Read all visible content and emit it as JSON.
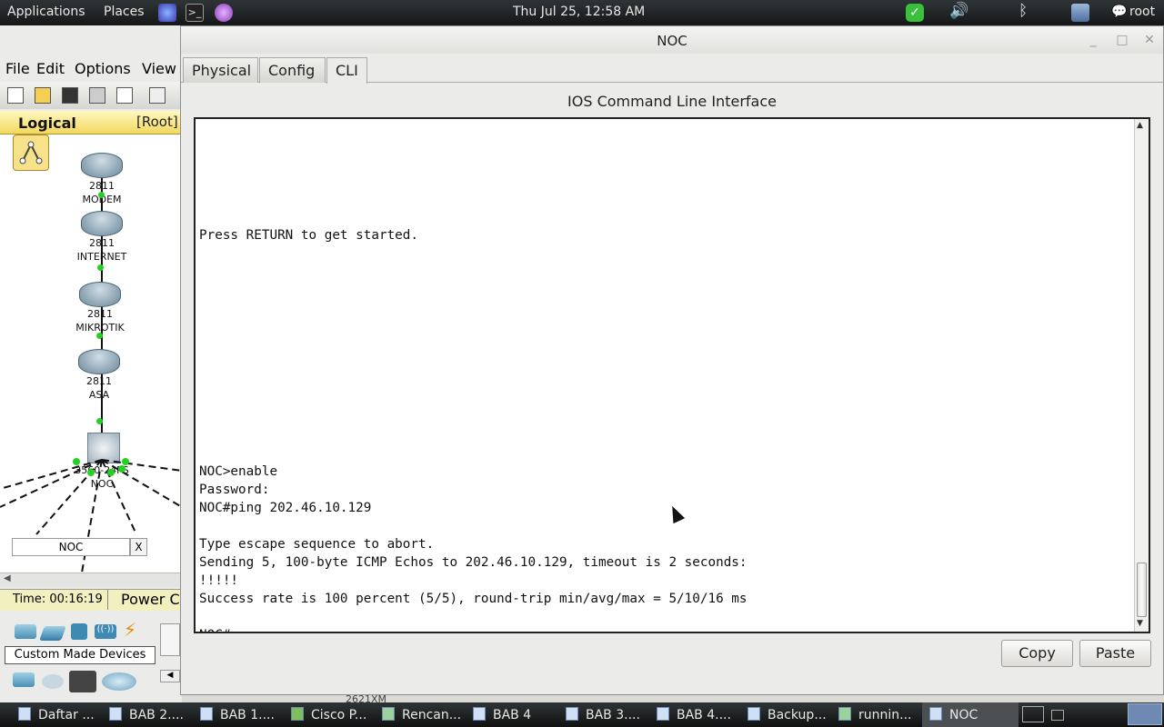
{
  "topbar": {
    "applications": "Applications",
    "places": "Places",
    "clock": "Thu Jul 25, 12:58 AM",
    "user": "root"
  },
  "packet_tracer": {
    "menu": [
      "File",
      "Edit",
      "Options",
      "View"
    ],
    "logical_label": "Logical",
    "root_label": "[Root]",
    "devices": [
      {
        "model": "2811",
        "name": "MODEM"
      },
      {
        "model": "2811",
        "name": "INTERNET"
      },
      {
        "model": "2811",
        "name": "MIKROTIK"
      },
      {
        "model": "2811",
        "name": "ASA"
      },
      {
        "model": "3560-24PS",
        "name": "NOC"
      }
    ],
    "search_value": "NOC",
    "search_clear": "X",
    "time": "Time: 00:16:19",
    "power": "Power C",
    "category": "Custom Made Devices",
    "partial_label": "2621XM"
  },
  "noc_window": {
    "title": "NOC",
    "tabs": [
      "Physical",
      "Config",
      "CLI"
    ],
    "active_tab": "CLI",
    "cli_title": "IOS Command Line Interface",
    "terminal_lines": [
      "",
      "",
      "",
      "",
      "",
      "",
      "Press RETURN to get started.",
      "",
      "",
      "",
      "",
      "",
      "",
      "",
      "",
      "",
      "",
      "",
      "",
      "NOC>enable",
      "Password:",
      "NOC#ping 202.46.10.129",
      "",
      "Type escape sequence to abort.",
      "Sending 5, 100-byte ICMP Echos to 202.46.10.129, timeout is 2 seconds:",
      "!!!!!",
      "Success rate is 100 percent (5/5), round-trip min/avg/max = 5/10/16 ms",
      "",
      "NOC#"
    ],
    "copy_label": "Copy",
    "paste_label": "Paste"
  },
  "taskbar": {
    "items": [
      "Daftar ...",
      "BAB 2....",
      "BAB 1....",
      "Cisco P...",
      "Rencan...",
      "BAB 4",
      "BAB 3....",
      "BAB 4....",
      "Backup...",
      "runnin...",
      "NOC"
    ]
  }
}
